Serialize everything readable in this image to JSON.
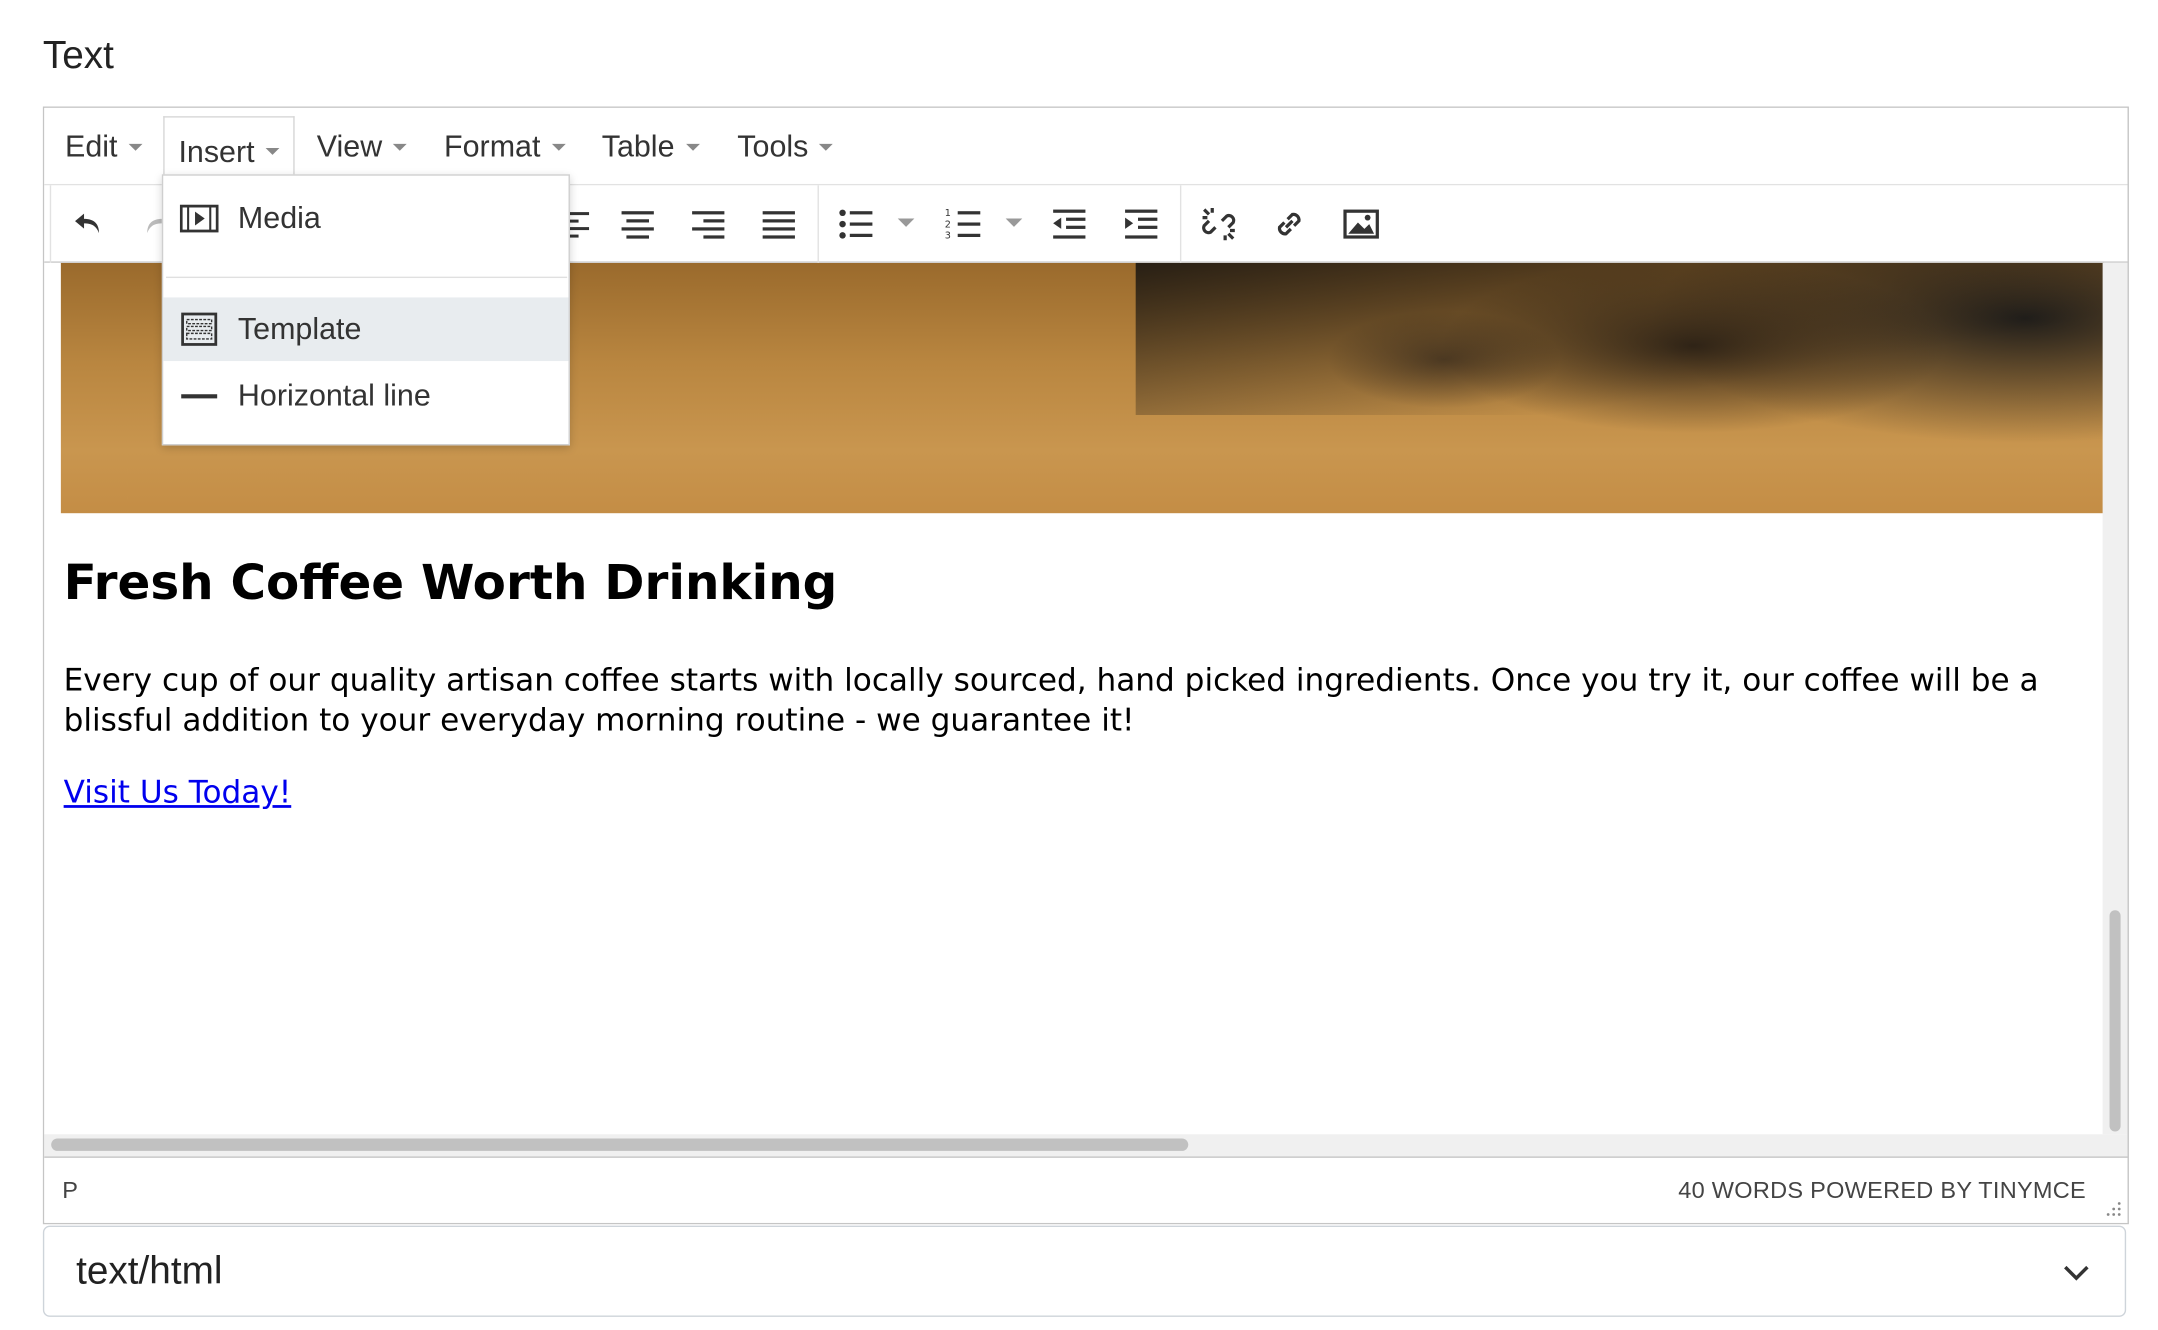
{
  "field_label": "Text",
  "menubar": {
    "items": [
      {
        "label": "Edit"
      },
      {
        "label": "Insert"
      },
      {
        "label": "View"
      },
      {
        "label": "Format"
      },
      {
        "label": "Table"
      },
      {
        "label": "Tools"
      }
    ]
  },
  "toolbar": {
    "buttons": [
      "undo-icon",
      "redo-icon",
      "align-left-icon",
      "align-center-icon",
      "align-right-icon",
      "align-justify-icon",
      "bullet-list-icon",
      "numbered-list-icon",
      "outdent-icon",
      "indent-icon",
      "unlink-icon",
      "link-icon",
      "image-icon"
    ]
  },
  "insert_menu": {
    "items": [
      {
        "label": "Media",
        "icon": "media-icon"
      },
      {
        "label": "Template",
        "icon": "template-icon"
      },
      {
        "label": "Horizontal line",
        "icon": "horizontal-line-icon"
      }
    ]
  },
  "content": {
    "headline": "Fresh Coffee Worth Drinking",
    "body": "Every cup of our quality artisan coffee starts with locally sourced, hand picked ingredients. Once you try it, our coffee will be a blissful addition to your everyday morning routine - we guarantee it!",
    "link": "Visit Us Today!"
  },
  "statusbar": {
    "path": "P",
    "right": "40 WORDS POWERED BY TINYMCE"
  },
  "format_select": {
    "value": "text/html"
  }
}
